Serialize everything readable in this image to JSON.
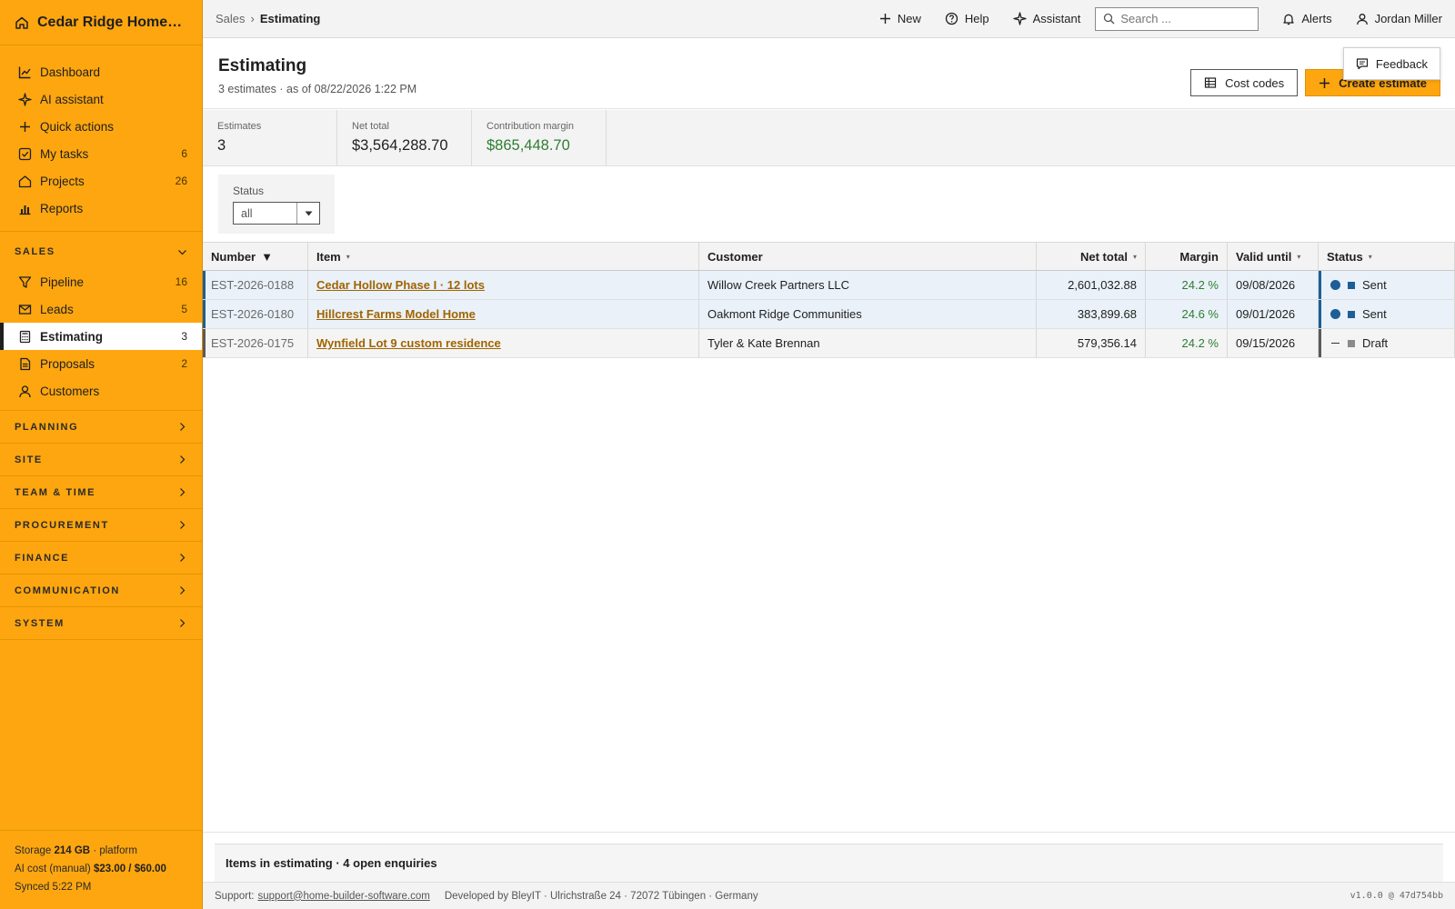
{
  "brand": {
    "name": "Cedar Ridge Homes L..."
  },
  "nav": {
    "main": [
      {
        "label": "Dashboard",
        "count": ""
      },
      {
        "label": "AI assistant",
        "count": ""
      },
      {
        "label": "Quick actions",
        "count": ""
      },
      {
        "label": "My tasks",
        "count": "6"
      },
      {
        "label": "Projects",
        "count": "26"
      },
      {
        "label": "Reports",
        "count": ""
      }
    ],
    "sales_title": "SALES",
    "sales": [
      {
        "label": "Pipeline",
        "count": "16"
      },
      {
        "label": "Leads",
        "count": "5"
      },
      {
        "label": "Estimating",
        "count": "3"
      },
      {
        "label": "Proposals",
        "count": "2"
      },
      {
        "label": "Customers",
        "count": ""
      }
    ],
    "sections": [
      "PLANNING",
      "SITE",
      "TEAM & TIME",
      "PROCUREMENT",
      "FINANCE",
      "COMMUNICATION",
      "SYSTEM"
    ]
  },
  "sidebar_footer": {
    "storage_label": "Storage",
    "storage_value": "214 GB",
    "storage_suffix": "· platform",
    "ai_cost_label": "AI cost (manual)",
    "ai_cost_value": "$23.00 / $60.00",
    "synced": "Synced 5:22 PM"
  },
  "topbar": {
    "breadcrumb_parent": "Sales",
    "breadcrumb_sep": "›",
    "breadcrumb_current": "Estimating",
    "new_label": "New",
    "help_label": "Help",
    "assistant_label": "Assistant",
    "search_placeholder": "Search ...",
    "alerts_label": "Alerts",
    "user_name": "Jordan Miller"
  },
  "header": {
    "title": "Estimating",
    "subtitle": "3 estimates · as of 08/22/2026 1:22 PM",
    "cost_codes_label": "Cost codes",
    "create_label": "Create estimate",
    "feedback_label": "Feedback"
  },
  "kpis": [
    {
      "label": "Estimates",
      "value": "3"
    },
    {
      "label": "Net total",
      "value": "$3,564,288.70"
    },
    {
      "label": "Contribution margin",
      "value": "$865,448.70"
    }
  ],
  "filter": {
    "label": "Status",
    "value": "all"
  },
  "table": {
    "columns": [
      "Number",
      "Item",
      "Customer",
      "Net total",
      "Margin",
      "Valid until",
      "Status"
    ],
    "sort_glyph": "▼",
    "rows": [
      {
        "number": "EST-2026-0188",
        "item": "Cedar Hollow Phase I · 12 lots",
        "customer": "Willow Creek Partners LLC",
        "net_total": "2,601,032.88",
        "margin": "24.2 %",
        "valid_until": "09/08/2026",
        "status": "Sent"
      },
      {
        "number": "EST-2026-0180",
        "item": "Hillcrest Farms Model Home",
        "customer": "Oakmont Ridge Communities",
        "net_total": "383,899.68",
        "margin": "24.6 %",
        "valid_until": "09/01/2026",
        "status": "Sent"
      },
      {
        "number": "EST-2026-0175",
        "item": "Wynfield Lot 9 custom residence",
        "customer": "Tyler & Kate Brennan",
        "net_total": "579,356.14",
        "margin": "24.2 %",
        "valid_until": "09/15/2026",
        "status": "Draft"
      }
    ]
  },
  "enquiries_bar": "Items in estimating · 4 open enquiries",
  "footer": {
    "support_label": "Support:",
    "support_email": "support@home-builder-software.com",
    "developer": "Developed by BleyIT · Ulrichstraße 24 · 72072 Tübingen · Germany",
    "version": "v1.0.0 @ 47d754bb"
  },
  "colors": {
    "accent": "#fda60f",
    "sent": "#1d5e96",
    "draft": "#8a8a8a",
    "positive": "#2e7d32",
    "link": "#a06400"
  }
}
